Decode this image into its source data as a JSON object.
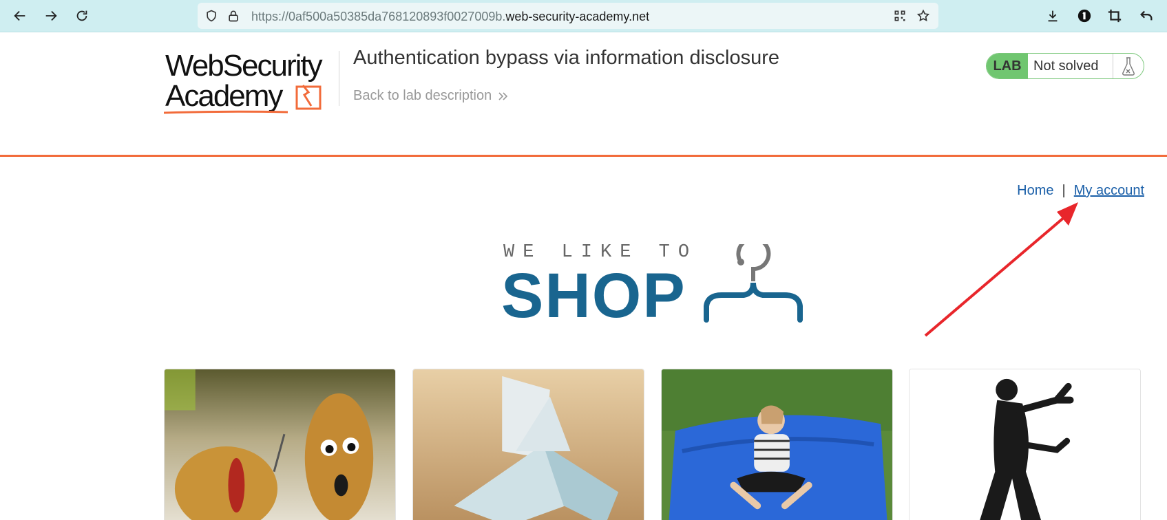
{
  "browser": {
    "url_protocol": "https://",
    "url_subdomain": "0af500a50385da768120893f0027009b.",
    "url_domain": "web-security-academy.net"
  },
  "lab": {
    "logo_line1": "WebSecurity",
    "logo_line2": "Academy",
    "title": "Authentication bypass via information disclosure",
    "back_link": "Back to lab description",
    "badge_label": "LAB",
    "status": "Not solved"
  },
  "nav": {
    "home": "Home",
    "separator": "|",
    "account": "My account"
  },
  "banner": {
    "tagline": "WE LIKE TO",
    "word": "SHOP"
  },
  "colors": {
    "toolbar": "#cfeef1",
    "accent_orange": "#f26b3a",
    "shop_blue": "#19658f",
    "link_blue": "#1a5fa8",
    "lab_green": "#70c670",
    "annotation_red": "#e8262b"
  },
  "products": [
    {
      "image": "potatoes"
    },
    {
      "image": "paper-bird"
    },
    {
      "image": "blue-beanbag-girl"
    },
    {
      "image": "dancing-silhouette"
    }
  ]
}
